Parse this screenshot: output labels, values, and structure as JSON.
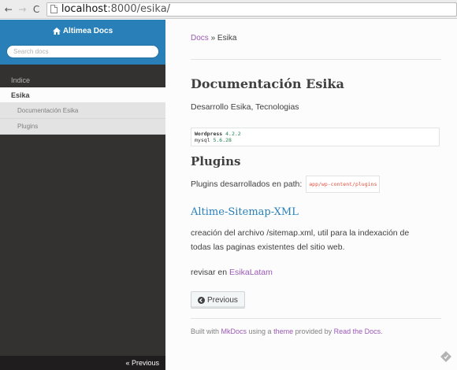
{
  "browser": {
    "back_glyph": "←",
    "forward_glyph": "→",
    "reload_glyph": "C",
    "url_host": "localhost",
    "url_path": ":8000/esika/"
  },
  "sidebar": {
    "brand": "Altimea Docs",
    "search_placeholder": "Search docs",
    "caption": "Indice",
    "current": "Esika",
    "subitems": [
      "Documentación Esika",
      "Plugins"
    ],
    "bottom_previous": "« Previous"
  },
  "breadcrumbs": {
    "root": "Docs",
    "separator": " » ",
    "current": "Esika"
  },
  "main": {
    "title": "Documentación Esika",
    "subtitle": "Desarrollo Esika, Tecnologias",
    "code": {
      "line1_name": "Wordpress ",
      "line1_version": "4.2.2",
      "line2_name": "mysql ",
      "line2_version": "5.6.28"
    },
    "plugins_heading": "Plugins",
    "plugins_text": "Plugins desarrollados en path:",
    "plugins_path": "app/wp-content/plugins",
    "sitemap_heading": "Altime-Sitemap-XML",
    "sitemap_desc": "creación del archivo /sitemap.xml, util para la indexación de todas las paginas existentes del sitio web.",
    "revisar_text": "revisar en ",
    "revisar_link": "EsikaLatam",
    "previous_button": "Previous"
  },
  "footer": {
    "built_with": "Built with ",
    "mkdocs": "MkDocs",
    "using_a": " using a ",
    "theme": "theme",
    "provided_by": " provided by ",
    "read_the_docs": "Read the Docs",
    "period": "."
  },
  "colors": {
    "sidebar_top": "#2980b9",
    "sidebar_bg": "#343131",
    "link": "#9b59b6",
    "heading3": "#2980b9"
  }
}
